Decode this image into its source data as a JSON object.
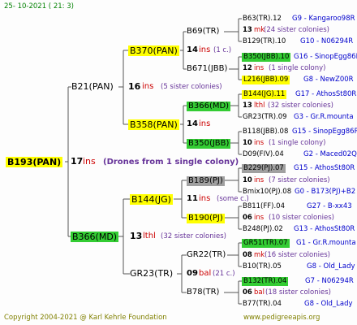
{
  "header": {
    "date": "25- 10-2021 ( 21: 3)"
  },
  "footer": {
    "copyright": "Copyright 2004-2021 @ Karl Kehrle Foundation",
    "site": "www.pedigreeapis.org"
  },
  "root": {
    "name": "B193(PAN)",
    "count": "17",
    "unit": "ins",
    "note": "(Drones from 1 single colony)"
  },
  "gen1": [
    {
      "name": "B21(PAN)",
      "count": "16",
      "unit": "ins",
      "note": "(5 sister colonies)"
    },
    {
      "name": "B366(MD)",
      "count": "13",
      "unit": "lthl",
      "note": "(32 sister colonies)"
    }
  ],
  "gen2": [
    {
      "name": "B370(PAN)",
      "count": "14",
      "unit": "ins",
      "note": "(1 c.)"
    },
    {
      "name": "B358(PAN)",
      "count": "14",
      "unit": "ins",
      "note": ""
    },
    {
      "name": "B144(JG)",
      "count": "11",
      "unit": "ins",
      "note": "(some c.)"
    },
    {
      "name": "GR23(TR)",
      "count": "09",
      "unit": "bal",
      "note": "(21 c.)"
    }
  ],
  "gen3": [
    {
      "name": "B69(TR)"
    },
    {
      "name": "B671(JBB)"
    },
    {
      "name": "B366(MD)"
    },
    {
      "name": "B350(JBB)"
    },
    {
      "name": "B189(PJ)"
    },
    {
      "name": "B190(PJ)"
    },
    {
      "name": "GR22(TR)"
    },
    {
      "name": "B78(TR)"
    }
  ],
  "gen4": [
    {
      "name": "B63(TR).12",
      "ref": "G9 - Kangaroo98R"
    },
    {
      "count": "13",
      "unit": "mk",
      "note": "(24 sister colonies)"
    },
    {
      "name": "B129(TR).10",
      "ref": "G10 - N06294R"
    },
    {
      "name": "B350(JBB).10",
      "ref": "G16 - SinopEgg86R"
    },
    {
      "count": "12",
      "unit": "ins",
      "note": "(1 single colony)"
    },
    {
      "name": "L216(JBB).09",
      "ref": "G8 - NewZ00R"
    },
    {
      "name": "B144(JG).11",
      "ref": "G17 - AthosSt80R"
    },
    {
      "count": "13",
      "unit": "lthl",
      "note": "(32 sister colonies)"
    },
    {
      "name": "GR23(TR).09",
      "ref": "G3 - Gr.R.mounta"
    },
    {
      "name": "B118(JBB).08",
      "ref": "G15 - SinopEgg86R"
    },
    {
      "count": "10",
      "unit": "ins",
      "note": "(1 single colony)"
    },
    {
      "name": "D09(FIV).04",
      "ref": "G2 - Maced02Q"
    },
    {
      "name": "B229(PJ).07",
      "ref": "G15 - AthosSt80R"
    },
    {
      "count": "10",
      "unit": "ins",
      "note": "(7 sister colonies)"
    },
    {
      "name": "Bmix10(PJ).08",
      "ref": "G0 - B173(PJ)+B2"
    },
    {
      "name": "B811(FF).04",
      "ref": "G27 - B-xx43"
    },
    {
      "count": "06",
      "unit": "ins",
      "note": "(10 sister colonies)"
    },
    {
      "name": "B248(PJ).02",
      "ref": "G13 - AthosSt80R"
    },
    {
      "name": "GR51(TR).07",
      "ref": "G1 - Gr.R.mounta"
    },
    {
      "count": "08",
      "unit": "mk",
      "note": "(16 sister colonies)"
    },
    {
      "name": "B10(TR).05",
      "ref": "G8 - Old_Lady"
    },
    {
      "name": "B132(TR).04",
      "ref": "G7 - N06294R"
    },
    {
      "count": "06",
      "unit": "bal",
      "note": "(18 sister colonies)"
    },
    {
      "name": "B77(TR).04",
      "ref": "G8 - Old_Lady"
    }
  ],
  "colors": {
    "highlight_yellow": "#ffff00",
    "highlight_green": "#33cc33",
    "highlight_gray": "#a0a0a0",
    "ref_blue": "#0000cc",
    "note_purple": "#663399",
    "unit_red": "#cc0000",
    "footer_olive": "#808000"
  }
}
